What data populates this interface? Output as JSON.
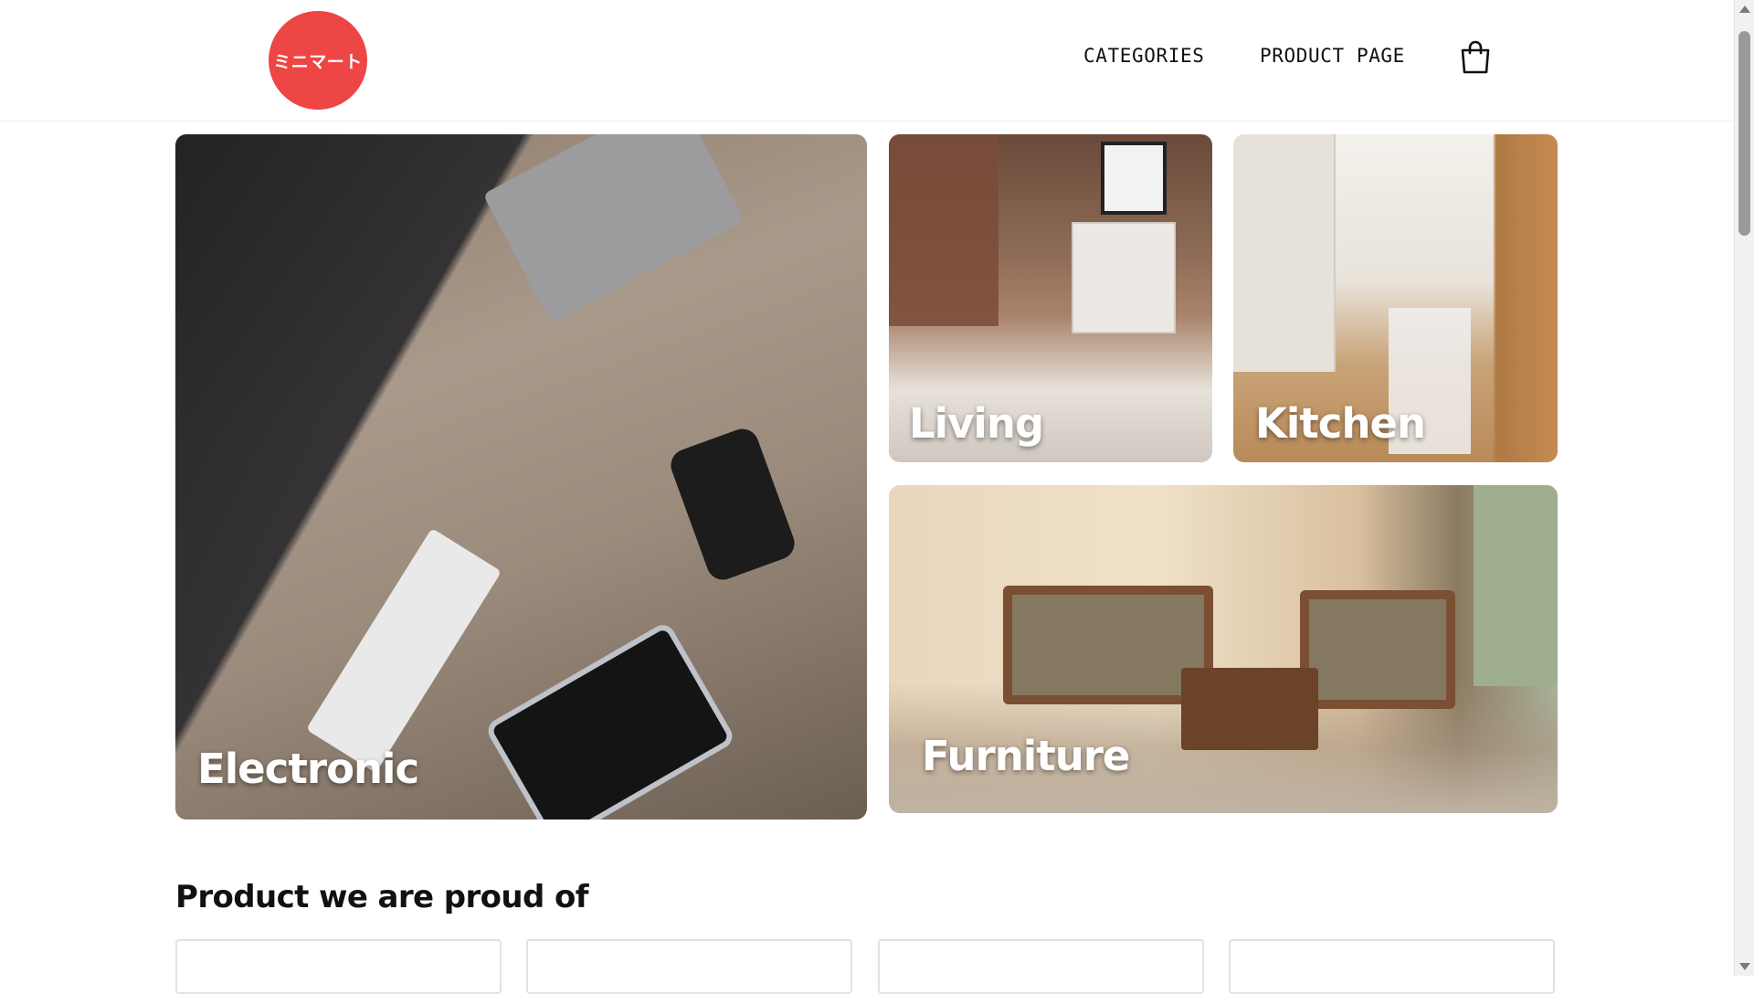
{
  "header": {
    "logo_text": "ミニマート",
    "nav": {
      "categories": "CATEGORIES",
      "product_page": "PRODUCT PAGE"
    },
    "cart_icon": "shopping-bag-icon"
  },
  "categories": [
    {
      "id": "electronic",
      "label": "Electronic"
    },
    {
      "id": "living",
      "label": "Living"
    },
    {
      "id": "kitchen",
      "label": "Kitchen"
    },
    {
      "id": "furniture",
      "label": "Furniture"
    }
  ],
  "section": {
    "title": "Product we are proud of"
  },
  "colors": {
    "logo": "#ee4545",
    "text": "#111111"
  }
}
